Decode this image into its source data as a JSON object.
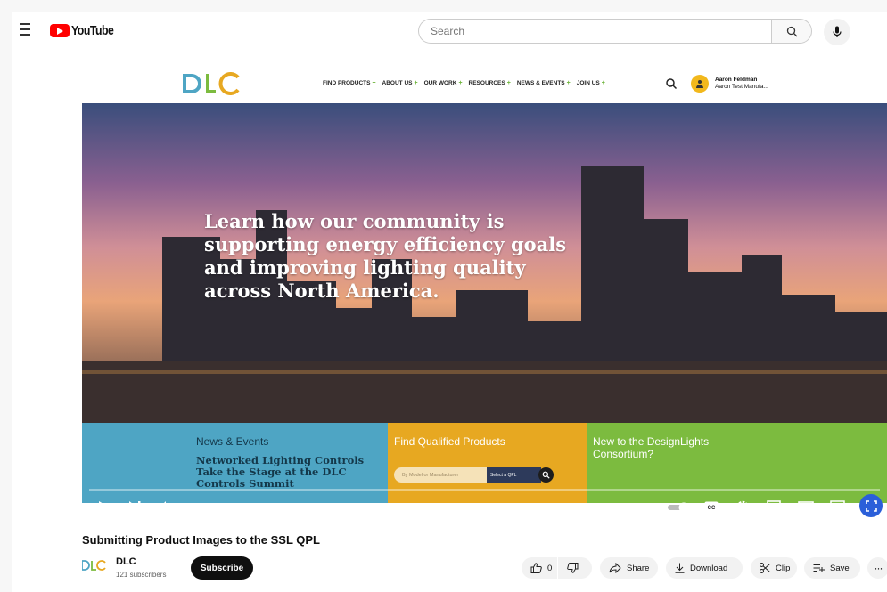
{
  "youtube": {
    "logo_text": "YouTube",
    "search_placeholder": "Search"
  },
  "embedded_site": {
    "menu": [
      "FIND PRODUCTS",
      "ABOUT US",
      "OUR WORK",
      "RESOURCES",
      "NEWS & EVENTS",
      "JOIN US"
    ],
    "user": {
      "name": "Aaron Feldman",
      "company": "Aaron Test Manufa..."
    },
    "hero_text": "Learn how our community is supporting energy efficiency goals and improving lighting quality across North America.",
    "cards": {
      "news": {
        "label": "News & Events",
        "headline": "Networked Lighting Controls Take the Stage at the DLC Controls Summit"
      },
      "products": {
        "label": "Find Qualified Products",
        "input_placeholder": "By Model or Manufacturer",
        "select": "Select a QPL"
      },
      "new": {
        "label": "New to the DesignLights Consortium?"
      }
    },
    "colors": {
      "news": "#4ea5c4",
      "products": "#e7a821",
      "new": "#7cbb3f"
    }
  },
  "player": {
    "time": "0:00 / 8:12",
    "progress_fraction": 0.0
  },
  "video": {
    "title": "Submitting Product Images to the SSL QPL",
    "channel": "DLC",
    "subscribers": "121 subscribers",
    "subscribe_label": "Subscribe",
    "likes": "0",
    "share_label": "Share",
    "download_label": "Download",
    "clip_label": "Clip",
    "save_label": "Save"
  }
}
